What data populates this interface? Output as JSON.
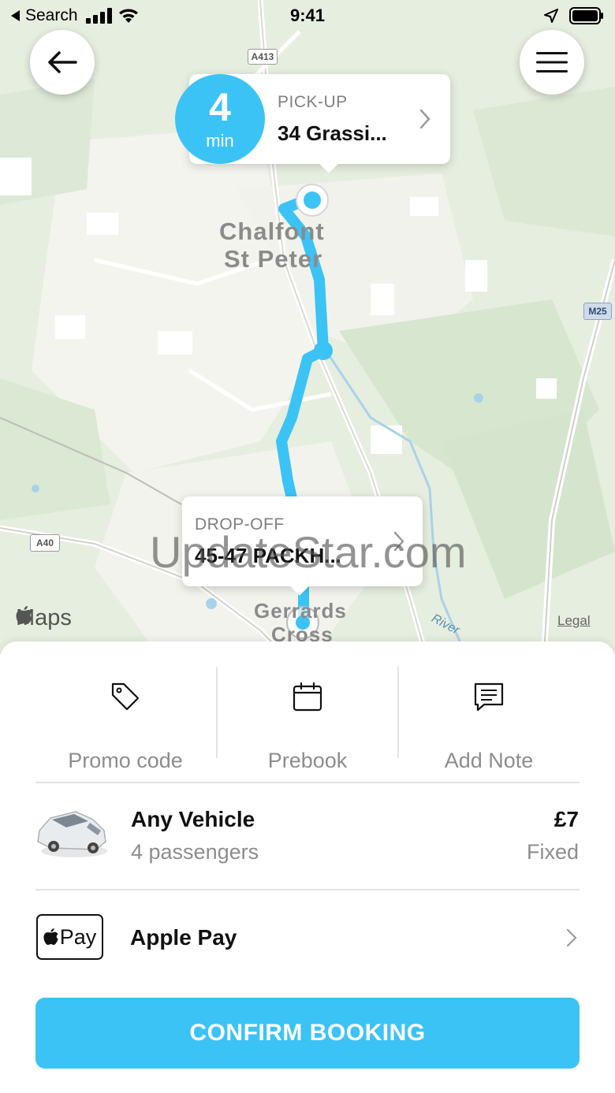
{
  "status_bar": {
    "back_app": "Search",
    "time": "9:41"
  },
  "map": {
    "place_label_1": "Chalfont",
    "place_label_2": "St Peter",
    "place_label_3": "Gerrards",
    "place_label_4": "Cross",
    "road_a413": "A413",
    "road_m25": "M25",
    "road_a40": "A40",
    "river_label": "River",
    "maps_brand": "Maps",
    "legal_link": "Legal",
    "route_color": "#3cc3f6"
  },
  "eta": {
    "value": "4",
    "unit": "min"
  },
  "pickup": {
    "label": "PICK-UP",
    "address": "34 Grassi..."
  },
  "dropoff": {
    "label": "DROP-OFF",
    "address": "45-47 PACKH..."
  },
  "watermark": "UpdateStar.com",
  "options": {
    "promo": "Promo code",
    "prebook": "Prebook",
    "note": "Add Note"
  },
  "vehicle": {
    "name": "Any Vehicle",
    "passengers": "4 passengers",
    "price": "£7",
    "price_type": "Fixed"
  },
  "payment": {
    "badge": "Pay",
    "method": "Apple Pay"
  },
  "confirm_label": "CONFIRM BOOKING",
  "accent_color": "#3cc3f6"
}
